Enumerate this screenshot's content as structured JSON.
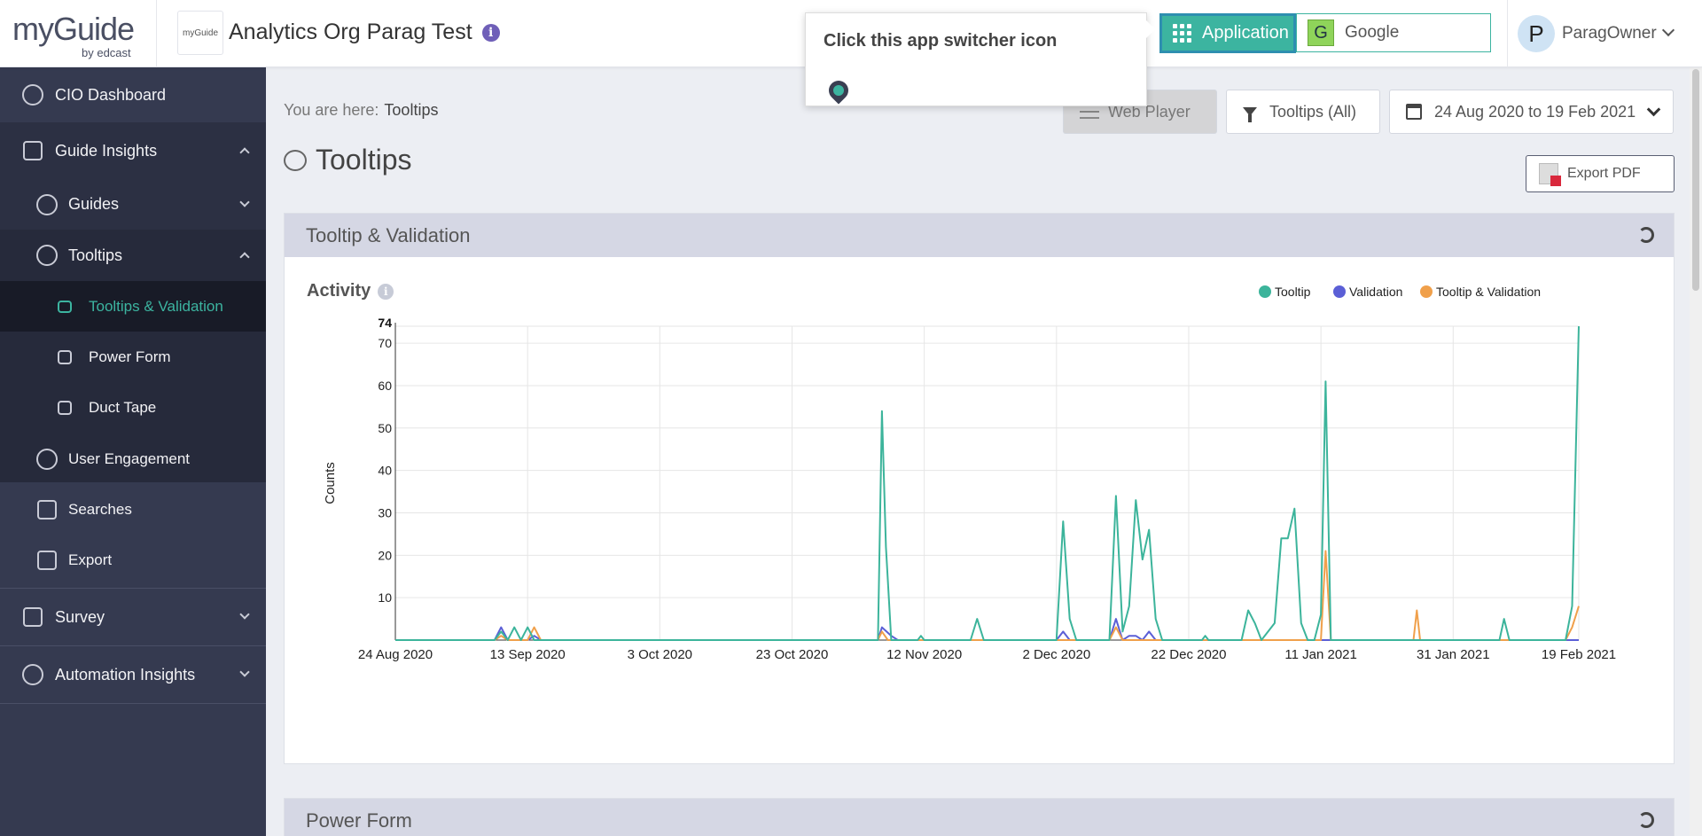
{
  "header": {
    "brand_word": "myGuide",
    "brand_sub": "by edcast",
    "org_logo_text": "myGuide",
    "org_title": "Analytics Org Parag Test",
    "app_button_label": "Application",
    "app_selected": "Google",
    "app_selected_initial": "G",
    "user_initial": "P",
    "user_name": "ParagOwner"
  },
  "tooltip_popup": {
    "text": "Click this app switcher icon"
  },
  "sidebar": {
    "items": [
      {
        "label": "CIO Dashboard"
      },
      {
        "label": "Guide Insights"
      },
      {
        "label": "Guides"
      },
      {
        "label": "Tooltips"
      },
      {
        "label": "Tooltips & Validation"
      },
      {
        "label": "Power Form"
      },
      {
        "label": "Duct Tape"
      },
      {
        "label": "User Engagement"
      },
      {
        "label": "Searches"
      },
      {
        "label": "Export"
      },
      {
        "label": "Survey"
      },
      {
        "label": "Automation Insights"
      }
    ]
  },
  "breadcrumb": {
    "prefix": "You are here:",
    "current": "Tooltips"
  },
  "page": {
    "title": "Tooltips"
  },
  "toolbar": {
    "web_player": "Web Player",
    "filter": "Tooltips (All)",
    "date_range": "24 Aug 2020 to 19 Feb 2021",
    "export": "Export PDF"
  },
  "sections": {
    "main_title": "Tooltip & Validation",
    "activity_label": "Activity",
    "activity_info": "i",
    "second_title": "Power Form"
  },
  "colors": {
    "tooltip": "#3cb49b",
    "validation": "#5b5fd6",
    "tooltip_validation": "#f0a04b",
    "accent": "#3cb4a0",
    "sidebar": "#353a50"
  },
  "chart_data": {
    "type": "line",
    "ylabel": "Counts",
    "ylim": [
      0,
      74
    ],
    "yticks": [
      10,
      20,
      30,
      40,
      50,
      60,
      70
    ],
    "ymax_label": "74",
    "x_tick_labels": [
      "24 Aug 2020",
      "13 Sep 2020",
      "3 Oct 2020",
      "23 Oct 2020",
      "12 Nov 2020",
      "2 Dec 2020",
      "22 Dec 2020",
      "11 Jan 2021",
      "31 Jan 2021",
      "19 Feb 2021"
    ],
    "x_tick_days": [
      0,
      20,
      40,
      60,
      80,
      100,
      120,
      140,
      160,
      179
    ],
    "legend": [
      "Tooltip",
      "Validation",
      "Tooltip & Validation"
    ],
    "legend_position": "top-right",
    "grid": true,
    "series": [
      {
        "name": "Tooltip",
        "points": [
          [
            0,
            0
          ],
          [
            15,
            0
          ],
          [
            16,
            2
          ],
          [
            17,
            0
          ],
          [
            18,
            3
          ],
          [
            19,
            0
          ],
          [
            20,
            3
          ],
          [
            21,
            0
          ],
          [
            73,
            0
          ],
          [
            73.6,
            54
          ],
          [
            74.2,
            22
          ],
          [
            75,
            0
          ],
          [
            79,
            0
          ],
          [
            79.5,
            1
          ],
          [
            80,
            0
          ],
          [
            87,
            0
          ],
          [
            88,
            5
          ],
          [
            89,
            0
          ],
          [
            100,
            0
          ],
          [
            101,
            28
          ],
          [
            102,
            5
          ],
          [
            103,
            0
          ],
          [
            108,
            0
          ],
          [
            109,
            34
          ],
          [
            110,
            2
          ],
          [
            111,
            8
          ],
          [
            112,
            33
          ],
          [
            113,
            19
          ],
          [
            114,
            26
          ],
          [
            115,
            5
          ],
          [
            116,
            0
          ],
          [
            122,
            0
          ],
          [
            122.5,
            1
          ],
          [
            123,
            0
          ],
          [
            128,
            0
          ],
          [
            129,
            7
          ],
          [
            130,
            4
          ],
          [
            131,
            0
          ],
          [
            133,
            4
          ],
          [
            134,
            24
          ],
          [
            135,
            24
          ],
          [
            136,
            31
          ],
          [
            137,
            4
          ],
          [
            138,
            0
          ],
          [
            139,
            0
          ],
          [
            140,
            6
          ],
          [
            140.7,
            61
          ],
          [
            141.5,
            0
          ],
          [
            167,
            0
          ],
          [
            167.7,
            5
          ],
          [
            168.5,
            0
          ],
          [
            177,
            0
          ],
          [
            178,
            8
          ],
          [
            179,
            74
          ]
        ]
      },
      {
        "name": "Validation",
        "points": [
          [
            0,
            0
          ],
          [
            15,
            0
          ],
          [
            16,
            3
          ],
          [
            17,
            0
          ],
          [
            20,
            0
          ],
          [
            21,
            1
          ],
          [
            22,
            0
          ],
          [
            73,
            0
          ],
          [
            73.6,
            3
          ],
          [
            75,
            1
          ],
          [
            76,
            0
          ],
          [
            100,
            0
          ],
          [
            101,
            2
          ],
          [
            102,
            0
          ],
          [
            108,
            0
          ],
          [
            109,
            5
          ],
          [
            110,
            0
          ],
          [
            111,
            1
          ],
          [
            112,
            1
          ],
          [
            113,
            0
          ],
          [
            114,
            2
          ],
          [
            115,
            0
          ],
          [
            179,
            0
          ]
        ]
      },
      {
        "name": "Tooltip & Validation",
        "points": [
          [
            0,
            0
          ],
          [
            15,
            0
          ],
          [
            16,
            1
          ],
          [
            17,
            0
          ],
          [
            20,
            0
          ],
          [
            21,
            3
          ],
          [
            22,
            0
          ],
          [
            73,
            0
          ],
          [
            73.6,
            2
          ],
          [
            74.5,
            0
          ],
          [
            108,
            0
          ],
          [
            109,
            3
          ],
          [
            110,
            0
          ],
          [
            140,
            0
          ],
          [
            140.7,
            21
          ],
          [
            141.5,
            0
          ],
          [
            154,
            0
          ],
          [
            154.5,
            7
          ],
          [
            155,
            0
          ],
          [
            177,
            0
          ],
          [
            178,
            3
          ],
          [
            179,
            8
          ]
        ]
      }
    ]
  }
}
